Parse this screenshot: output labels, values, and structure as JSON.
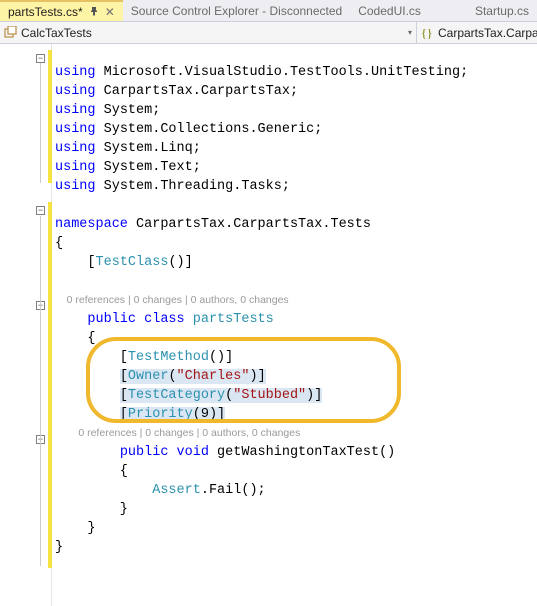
{
  "tabs": {
    "active": "partsTests.cs*",
    "t2": "Source Control Explorer - Disconnected",
    "t3": "CodedUI.cs",
    "t4": "Startup.cs"
  },
  "navbar": {
    "left_label": "CalcTaxTests",
    "right_label": "CarpartsTax.Carpar"
  },
  "codelens": {
    "class": "0 references | 0 changes | 0 authors, 0 changes",
    "method": "0 references | 0 changes | 0 authors, 0 changes"
  },
  "code": {
    "using1_ns": "Microsoft.VisualStudio.TestTools.UnitTesting",
    "using2_ns": "CarpartsTax.CarpartsTax",
    "using3_ns": "System",
    "using4_ns": "System.Collections.Generic",
    "using5_ns": "System.Linq",
    "using6_ns": "System.Text",
    "using7_ns": "System.Threading.Tasks",
    "namespace": "CarpartsTax.CarpartsTax.Tests",
    "attr_testclass": "TestClass",
    "class_name": "partsTests",
    "attr_testmethod": "TestMethod",
    "attr_owner": "Owner",
    "owner_val": "\"Charles\"",
    "attr_testcategory": "TestCategory",
    "testcategory_val": "\"Stubbed\"",
    "attr_priority": "Priority",
    "priority_val": "9",
    "method_name": "getWashingtonTaxTest",
    "assert_class": "Assert",
    "assert_method": "Fail",
    "kw_using": "using",
    "kw_namespace": "namespace",
    "kw_public": "public",
    "kw_class": "class",
    "kw_void": "void"
  }
}
